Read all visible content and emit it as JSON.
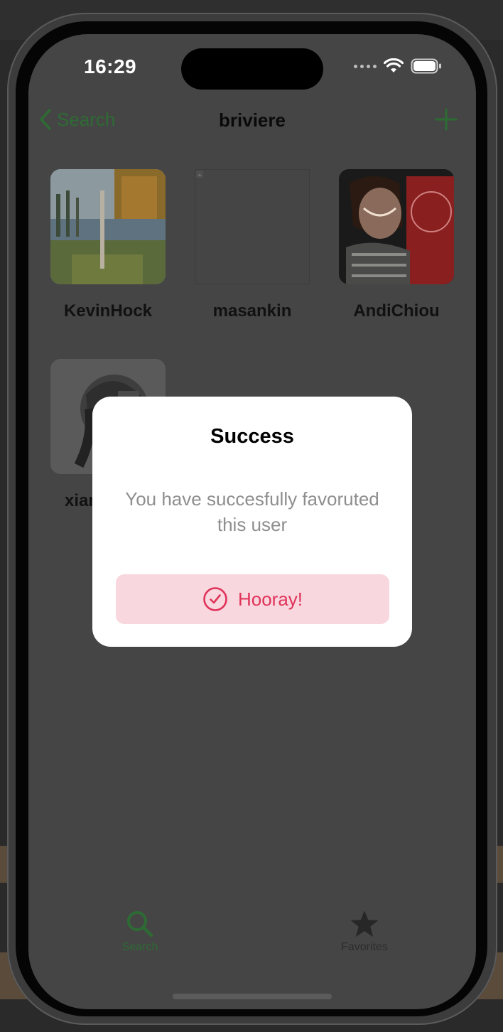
{
  "status_bar": {
    "time": "16:29"
  },
  "nav": {
    "back_label": "Search",
    "title": "briviere"
  },
  "followers": [
    {
      "name": "KevinHock"
    },
    {
      "name": "masankin"
    },
    {
      "name": "AndiChiou"
    },
    {
      "name": "xiar"
    }
  ],
  "alert": {
    "title": "Success",
    "message": "You have succesfully favoruted this user",
    "button_label": "Hooray!"
  },
  "tabs": [
    {
      "label": "Search",
      "icon": "magnifying-glass",
      "selected": true
    },
    {
      "label": "Favorites",
      "icon": "star",
      "selected": false
    }
  ],
  "colors": {
    "accent": "#2e6b34",
    "alert_button_bg": "#f8d7de",
    "alert_button_text": "#e0335a",
    "dim_overlay_screen": "#454545"
  }
}
